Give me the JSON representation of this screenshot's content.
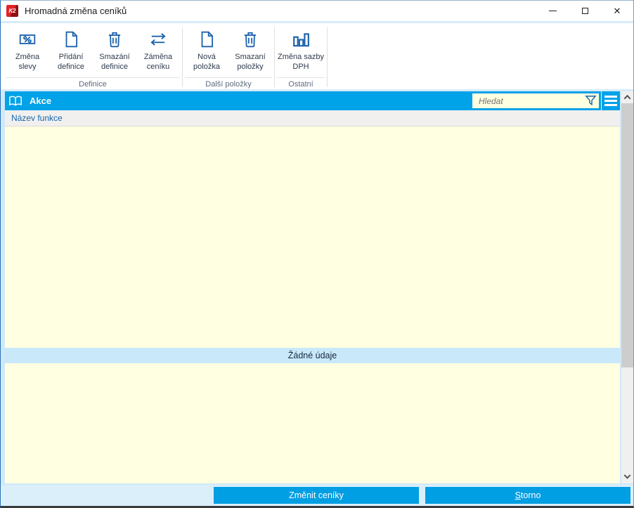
{
  "window": {
    "title": "Hromadná změna ceníků",
    "app_logo_text": "K2",
    "close_glyph": "✕"
  },
  "toolbar": {
    "groups": [
      {
        "label": "Definice",
        "buttons": [
          {
            "label": "Změna slevy",
            "icon": "discount-percent-icon"
          },
          {
            "label": "Přidání definice",
            "icon": "new-document-icon"
          },
          {
            "label": "Smazání definice",
            "icon": "trash-icon"
          },
          {
            "label": "Záměna ceníku",
            "icon": "swap-arrows-icon"
          }
        ]
      },
      {
        "label": "Další položky",
        "buttons": [
          {
            "label": "Nová položka",
            "icon": "new-document-icon"
          },
          {
            "label": "Smazaní položky",
            "icon": "trash-icon"
          }
        ]
      },
      {
        "label": "Ostatní",
        "buttons": [
          {
            "label": "Změna sazby DPH",
            "icon": "bar-chart-icon"
          }
        ]
      }
    ]
  },
  "panel": {
    "title": "Akce",
    "title_icon": "book-icon",
    "search_placeholder": "Hledat",
    "search_value": "",
    "column_header": "Název funkce",
    "empty_message": "Žádné údaje"
  },
  "footer": {
    "confirm_label": "Změnit ceníky",
    "cancel_accel": "S",
    "cancel_rest": "torno"
  },
  "colors": {
    "accent_blue": "#00a2e8",
    "grid_background": "#ffffe1",
    "empty_band_background": "#c9e9fb",
    "footer_background": "#dbeffb",
    "button_blue": "#009ee3",
    "icon_blue": "#1e63ad",
    "column_header_text": "#1565a9",
    "app_logo_red": "#e02227"
  }
}
